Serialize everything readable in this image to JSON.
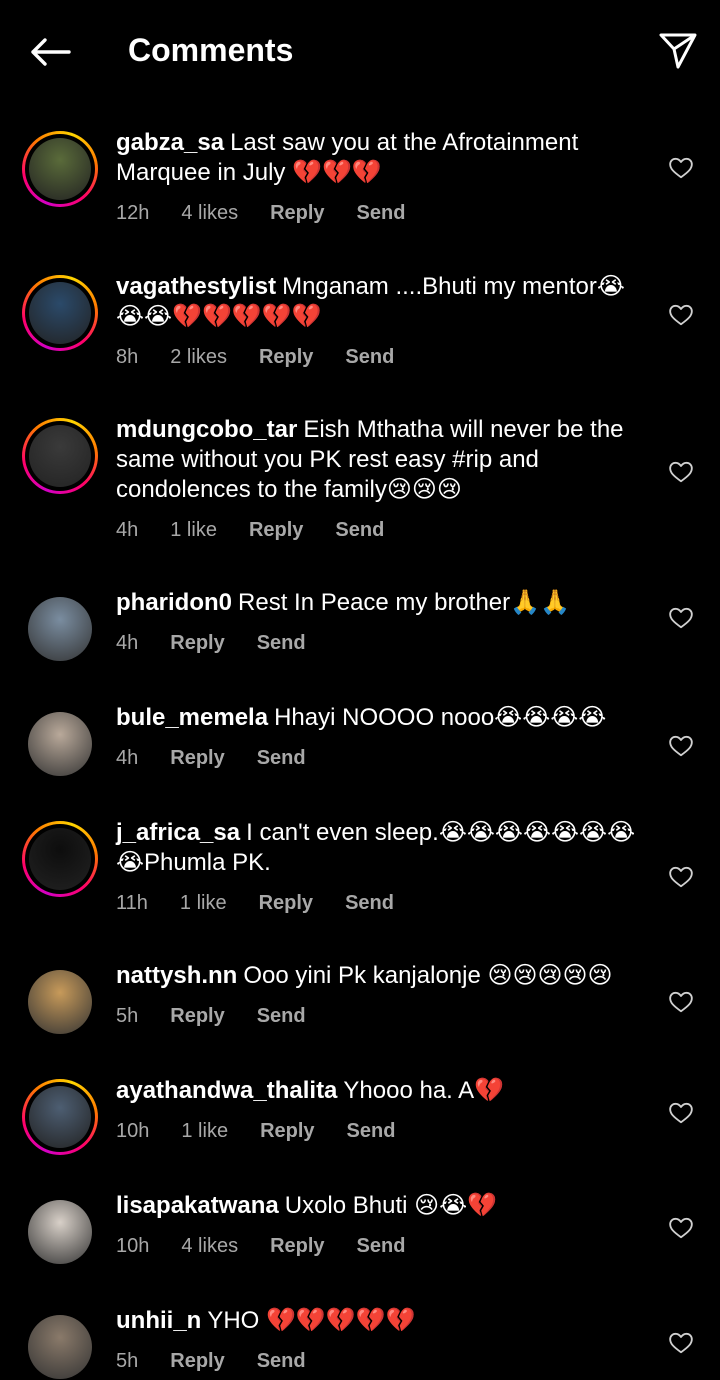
{
  "header": {
    "title": "Comments",
    "back_icon": "arrow-left-icon",
    "send_icon": "paper-plane-icon"
  },
  "actions": {
    "reply": "Reply",
    "send": "Send"
  },
  "comments": [
    {
      "username": "gabza_sa",
      "text": "Last saw you at the Afrotainment Marquee in July 💔💔💔",
      "time": "12h",
      "likes": "4 likes",
      "story_ring": true,
      "avatar_color": "#5a6b3a"
    },
    {
      "username": "vagathestylist",
      "text": "Mnganam ....Bhuti my mentor😭😭😭💔💔💔💔💔",
      "time": "8h",
      "likes": "2 likes",
      "story_ring": true,
      "avatar_color": "#2b4a6a"
    },
    {
      "username": "mdungcobo_tar",
      "text": "Eish Mthatha will never be the same without you PK rest easy #rip and condolences to the family😢😢😢",
      "time": "4h",
      "likes": "1 like",
      "story_ring": true,
      "avatar_color": "#3a3a3a"
    },
    {
      "username": "pharidon0",
      "text": "Rest In Peace my brother🙏🙏",
      "time": "4h",
      "likes": "",
      "story_ring": false,
      "avatar_color": "#7a8da0"
    },
    {
      "username": "bule_memela",
      "text": "Hhayi NOOOO nooo😭😭😭😭",
      "time": "4h",
      "likes": "",
      "story_ring": false,
      "avatar_color": "#b9a99a"
    },
    {
      "username": "j_africa_sa",
      "text": "I can't even sleep.😭😭😭😭😭😭😭😭Phumla PK.",
      "time": "11h",
      "likes": "1 like",
      "story_ring": true,
      "avatar_color": "#0d0d0d"
    },
    {
      "username": "nattysh.nn",
      "text": "Ooo yini Pk kanjalonje 😢😢😢😢😢",
      "time": "5h",
      "likes": "",
      "story_ring": false,
      "avatar_color": "#c79a5a"
    },
    {
      "username": "ayathandwa_thalita",
      "text": "Yhooo ha. A💔",
      "time": "10h",
      "likes": "1 like",
      "story_ring": true,
      "avatar_color": "#4d5e72"
    },
    {
      "username": "lisapakatwana",
      "text": "Uxolo Bhuti 😢😭💔",
      "time": "10h",
      "likes": "4 likes",
      "story_ring": false,
      "avatar_color": "#d8d0c8"
    },
    {
      "username": "unhii_n",
      "text": "YHO 💔💔💔💔💔",
      "time": "5h",
      "likes": "",
      "story_ring": false,
      "avatar_color": "#8a7a6a"
    }
  ]
}
